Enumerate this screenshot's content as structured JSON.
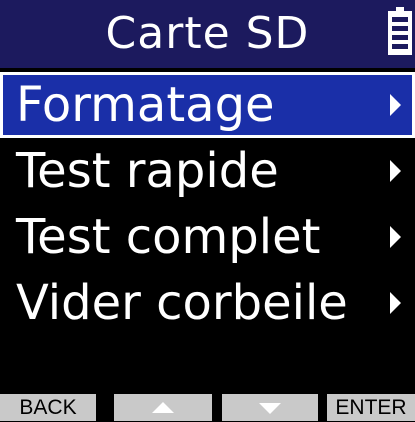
{
  "header": {
    "title": "Carte SD",
    "battery_icon": "battery-icon"
  },
  "menu": {
    "items": [
      {
        "label": "Formatage",
        "selected": true,
        "arrow_icon": "chevron-right-icon"
      },
      {
        "label": "Test rapide",
        "selected": false,
        "arrow_icon": "chevron-right-icon"
      },
      {
        "label": "Test complet",
        "selected": false,
        "arrow_icon": "chevron-right-icon"
      },
      {
        "label": "Vider corbeile",
        "selected": false,
        "arrow_icon": "chevron-right-icon"
      }
    ]
  },
  "footer": {
    "back_label": "BACK",
    "up_icon": "triangle-up-icon",
    "down_icon": "triangle-down-icon",
    "enter_label": "ENTER"
  },
  "colors": {
    "header_bg": "#1c1a5e",
    "selected_bg": "#1a2fa8",
    "footer_button_bg": "#c9c9c9"
  }
}
